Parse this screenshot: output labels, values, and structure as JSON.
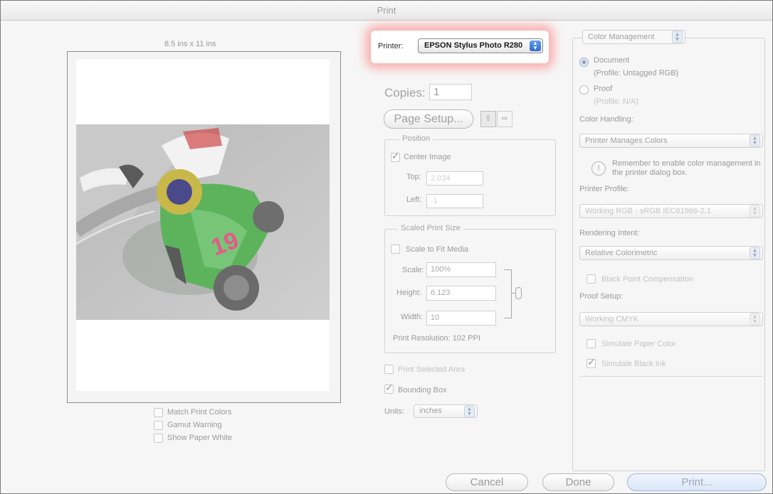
{
  "window": {
    "title": "Print"
  },
  "preview": {
    "paper_size": "8.5 ins x 11 ins",
    "checkboxes": [
      {
        "label": "Match Print Colors",
        "checked": false
      },
      {
        "label": "Gamut Warning",
        "checked": false
      },
      {
        "label": "Show Paper White",
        "checked": false
      }
    ]
  },
  "printer": {
    "label": "Printer:",
    "value": "EPSON Stylus Photo R280"
  },
  "copies": {
    "label": "Copies:",
    "value": "1"
  },
  "page_setup": {
    "label": "Page Setup..."
  },
  "position": {
    "title": "Position",
    "center_image": {
      "label": "Center Image",
      "checked": true
    },
    "top": {
      "label": "Top:",
      "value": "2.034"
    },
    "left": {
      "label": "Left:",
      "value": "-1"
    }
  },
  "scaled": {
    "title": "Scaled Print Size",
    "fit": {
      "label": "Scale to Fit Media",
      "checked": false
    },
    "scale": {
      "label": "Scale:",
      "value": "100%"
    },
    "height": {
      "label": "Height:",
      "value": "6.123"
    },
    "width": {
      "label": "Width:",
      "value": "10"
    },
    "resolution": "Print Resolution: 102 PPI"
  },
  "print_selected_area": {
    "label": "Print Selected Area",
    "checked": false
  },
  "bounding_box": {
    "label": "Bounding Box",
    "checked": true
  },
  "units": {
    "label": "Units:",
    "value": "inches"
  },
  "color": {
    "mode": "Color Management",
    "document": {
      "label": "Document",
      "profile": "(Profile: Untagged RGB)"
    },
    "proof": {
      "label": "Proof",
      "profile": "(Profile: N/A)"
    },
    "handling_label": "Color Handling:",
    "handling_value": "Printer Manages Colors",
    "note": "Remember to enable color management in the printer dialog box.",
    "printer_profile_label": "Printer Profile:",
    "printer_profile_value": "Working RGB - sRGB IEC61966-2.1",
    "intent_label": "Rendering Intent:",
    "intent_value": "Relative Colorimetric",
    "bpc": {
      "label": "Black Point Compensation",
      "checked": false
    },
    "proof_setup_label": "Proof Setup:",
    "proof_setup_value": "Working CMYK",
    "simulate_paper": {
      "label": "Simulate Paper Color",
      "checked": false
    },
    "simulate_ink": {
      "label": "Simulate Black Ink",
      "checked": true
    }
  },
  "buttons": {
    "cancel": "Cancel",
    "done": "Done",
    "print": "Print..."
  },
  "colors": {
    "highlight": "#ff8080",
    "accent": "#3a78d8",
    "photo_green": "#49a34a"
  }
}
